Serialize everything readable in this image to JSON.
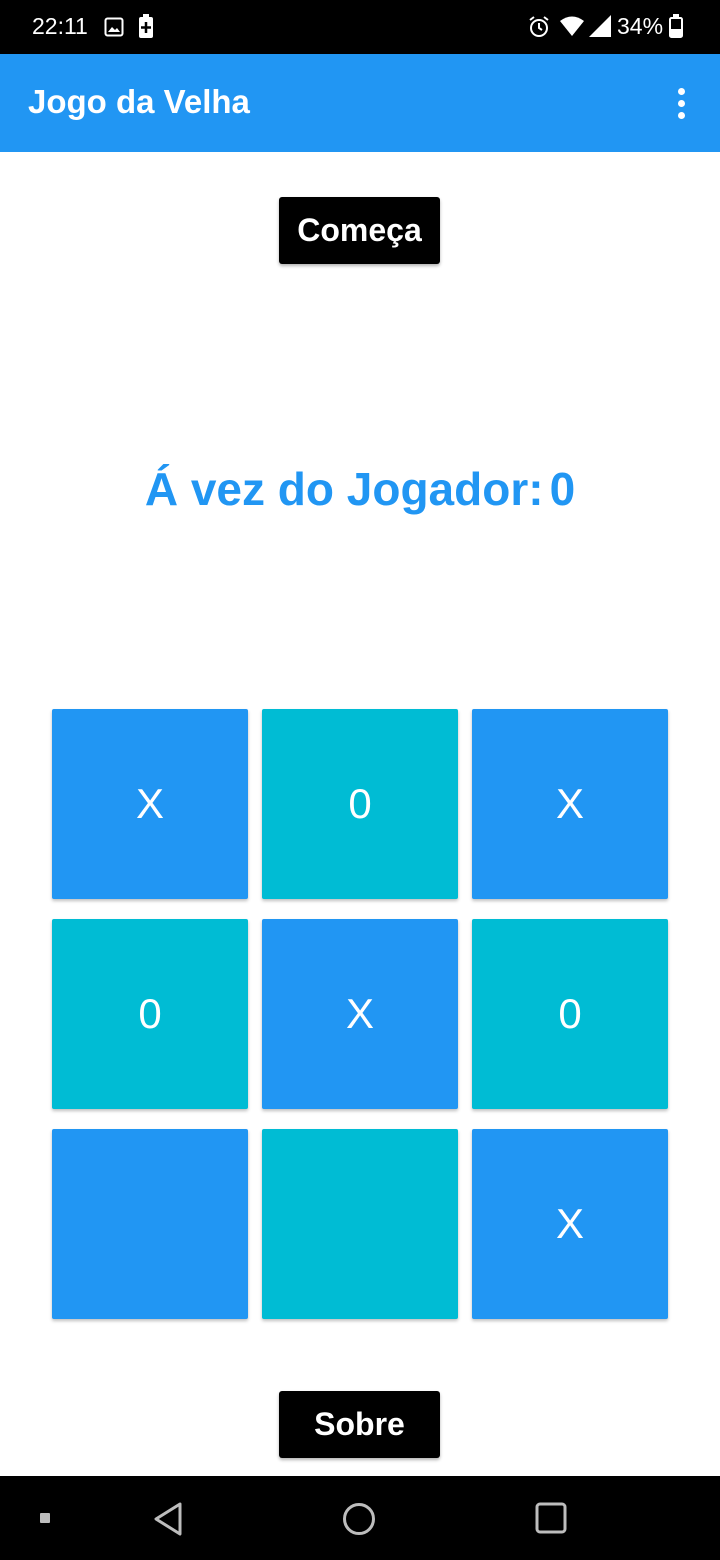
{
  "status_bar": {
    "time": "22:11",
    "battery": "34%",
    "icons": [
      "image-icon",
      "battery-saver-icon",
      "alarm-icon",
      "wifi-icon",
      "signal-icon",
      "battery-icon"
    ]
  },
  "app_bar": {
    "title": "Jogo da Velha",
    "menu_icon": "more-vert-icon"
  },
  "start_button": {
    "label": "Começa"
  },
  "turn": {
    "label": "Á vez do Jogador:",
    "player": "0"
  },
  "board": {
    "cells": [
      "X",
      "0",
      "X",
      "0",
      "X",
      "0",
      "",
      "",
      "X"
    ],
    "colors": {
      "blue": "#2196f3",
      "teal": "#00bcd4"
    }
  },
  "about_button": {
    "label": "Sobre"
  },
  "nav_bar": {
    "icons": [
      "recent-dot-icon",
      "back-icon",
      "home-icon",
      "overview-icon"
    ]
  },
  "colors": {
    "accent": "#2196f3",
    "secondary": "#00bcd4",
    "button": "#000000"
  }
}
